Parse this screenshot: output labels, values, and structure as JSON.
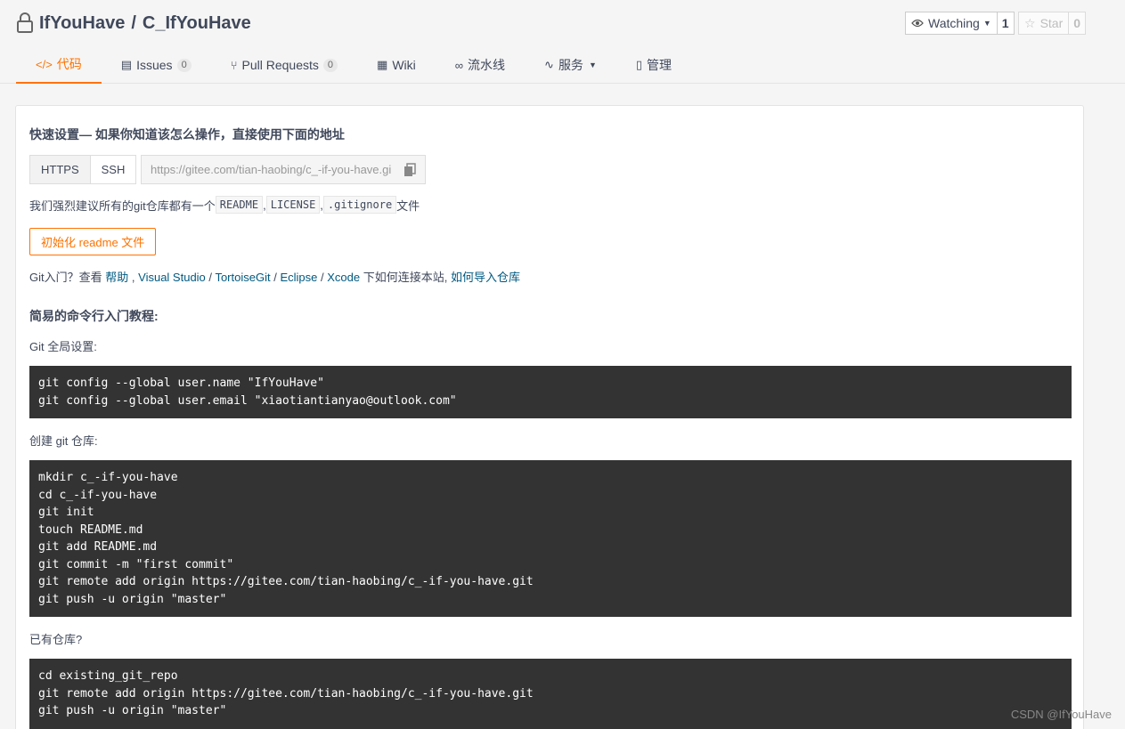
{
  "repo": {
    "owner": "IfYouHave",
    "separator": "/",
    "name": "C_IfYouHave"
  },
  "actions": {
    "watch_label": "Watching",
    "watch_count": "1",
    "star_label": "Star",
    "star_count": "0"
  },
  "tabs": [
    {
      "label": "代码"
    },
    {
      "label": "Issues",
      "count": "0"
    },
    {
      "label": "Pull Requests",
      "count": "0"
    },
    {
      "label": "Wiki"
    },
    {
      "label": "流水线"
    },
    {
      "label": "服务"
    },
    {
      "label": "管理"
    }
  ],
  "quick_setup": {
    "title": "快速设置— 如果你知道该怎么操作，直接使用下面的地址",
    "https": "HTTPS",
    "ssh": "SSH",
    "url": "https://gitee.com/tian-haobing/c_-if-you-have.git"
  },
  "recommend": {
    "prefix": "我们强烈建议所有的git仓库都有一个",
    "readme": "README",
    "sep1": ",",
    "license": "LICENSE",
    "sep2": ",",
    "gitignore": ".gitignore",
    "suffix": "文件"
  },
  "init_button": "初始化 readme 文件",
  "git_intro": {
    "prefix": "Git入门？查看",
    "help": "帮助",
    "sep_a": ",",
    "vs": "Visual Studio",
    "sep_b": "/",
    "tortoise": "TortoiseGit",
    "sep_c": "/",
    "eclipse": "Eclipse",
    "sep_d": "/",
    "xcode": "Xcode",
    "middle": "下如何连接本站,",
    "import": "如何导入仓库"
  },
  "tutorial": {
    "title": "简易的命令行入门教程:",
    "global_label": "Git 全局设置:",
    "global_cmds": [
      "git config --global user.name \"IfYouHave\"",
      "git config --global user.email \"xiaotiantianyao@outlook.com\""
    ],
    "create_label": "创建 git 仓库:",
    "create_cmds": [
      "mkdir c_-if-you-have",
      "cd c_-if-you-have",
      "git init",
      "touch README.md",
      "git add README.md",
      "git commit -m \"first commit\"",
      "git remote add origin https://gitee.com/tian-haobing/c_-if-you-have.git",
      "git push -u origin \"master\""
    ],
    "existing_label": "已有仓库?",
    "existing_cmds": [
      "cd existing_git_repo",
      "git remote add origin https://gitee.com/tian-haobing/c_-if-you-have.git",
      "git push -u origin \"master\""
    ]
  },
  "watermark": "CSDN @IfYouHave",
  "colors": {
    "accent": "#fe7300",
    "link": "#005980",
    "code_bg": "#333333"
  }
}
